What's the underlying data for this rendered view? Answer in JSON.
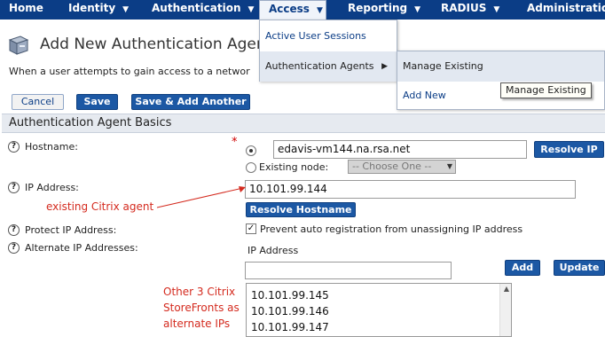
{
  "nav": {
    "items": [
      {
        "label": "Home"
      },
      {
        "label": "Identity"
      },
      {
        "label": "Authentication"
      },
      {
        "label": "Access"
      },
      {
        "label": "Reporting"
      },
      {
        "label": "RADIUS"
      },
      {
        "label": "Administration"
      }
    ]
  },
  "access_menu": {
    "items": [
      {
        "label": "Active User Sessions"
      },
      {
        "label": "Authentication Agents"
      }
    ]
  },
  "agents_submenu": {
    "items": [
      {
        "label": "Manage Existing"
      },
      {
        "label": "Add New"
      }
    ]
  },
  "tooltip": "Manage Existing",
  "page": {
    "title": "Add New Authentication Agent",
    "intro": "When a user attempts to gain access to a networ"
  },
  "actions": {
    "cancel": "Cancel",
    "save": "Save",
    "save_add": "Save & Add Another"
  },
  "section": {
    "title": "Authentication Agent Basics"
  },
  "form": {
    "help_glyph": "?",
    "hostname_label": "Hostname:",
    "required_mark": "*",
    "hostname_value": "edavis-vm144.na.rsa.net",
    "resolve_ip": "Resolve IP",
    "existing_node_label": "Existing node:",
    "existing_node_placeholder": "-- Choose One --",
    "ip_label": "IP Address:",
    "ip_value": "10.101.99.144",
    "resolve_hostname": "Resolve Hostname",
    "protect_label": "Protect IP Address:",
    "protect_checked": true,
    "protect_text": "Prevent auto registration from unassigning IP address",
    "alt_label": "Alternate IP Addresses:",
    "alt_column_header": "IP Address",
    "alt_input_value": "",
    "add": "Add",
    "update": "Update",
    "alt_list": [
      "10.101.99.145",
      "10.101.99.146",
      "10.101.99.147"
    ]
  },
  "annotations": {
    "citrix_agent": "existing Citrix agent",
    "storefronts": [
      "Other 3 Citrix",
      "StoreFronts as",
      "alternate IPs"
    ]
  },
  "colors": {
    "nav_bg": "#0b3d86",
    "primary_button": "#1c58a4",
    "annotation_red": "#d42a1e"
  }
}
